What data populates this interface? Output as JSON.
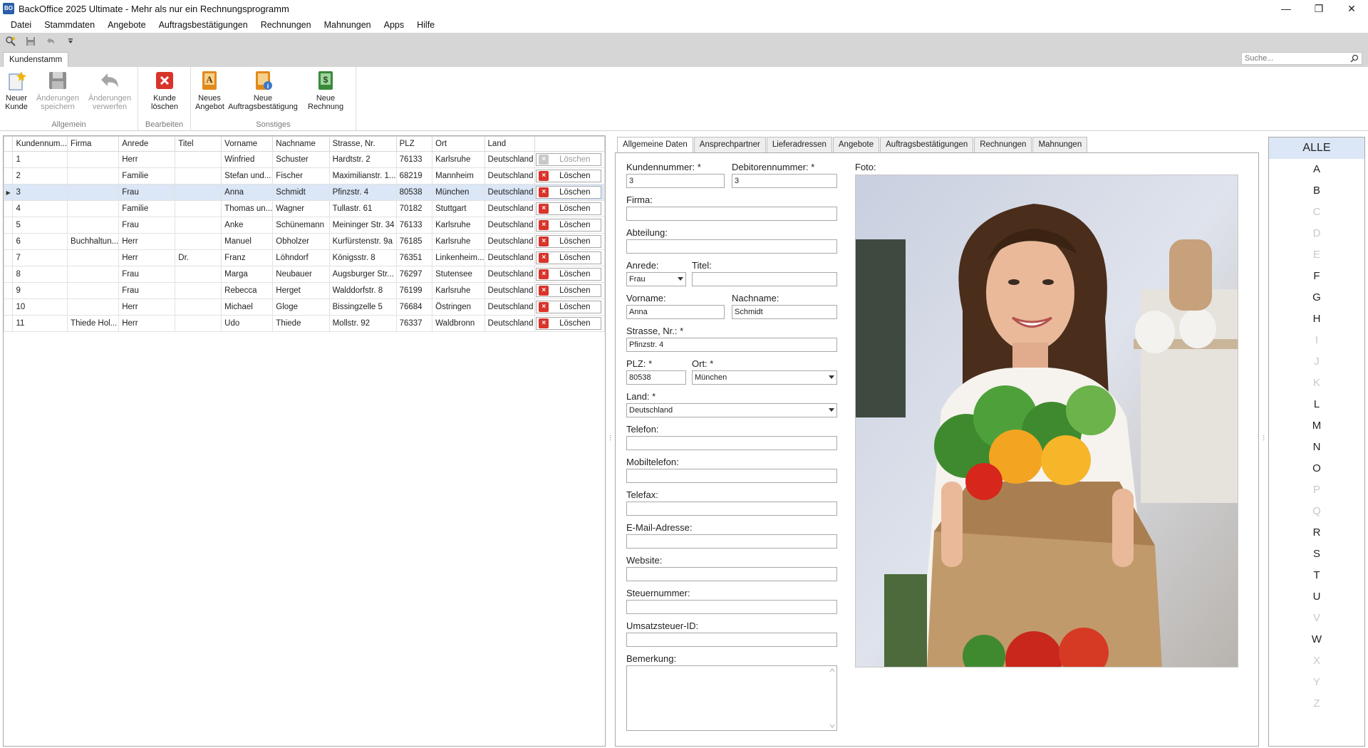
{
  "window": {
    "title": "BackOffice 2025 Ultimate - Mehr als nur ein Rechnungsprogramm",
    "app_icon_text": "BO",
    "minimize": "—",
    "maximize": "❐",
    "close": "✕"
  },
  "menu": [
    "Datei",
    "Stammdaten",
    "Angebote",
    "Auftragsbestätigungen",
    "Rechnungen",
    "Mahnungen",
    "Apps",
    "Hilfe"
  ],
  "ribbon_tab": "Kundenstamm",
  "search": {
    "placeholder": "Suche..."
  },
  "ribbon": {
    "groups": [
      "Allgemein",
      "Bearbeiten",
      "Sonstiges"
    ],
    "new_customer": "Neuer\nKunde",
    "save_changes": "Änderungen\nspeichern",
    "discard_changes": "Änderungen\nverwerfen",
    "delete_customer": "Kunde\nlöschen",
    "new_offer": "Neues\nAngebot",
    "new_order_confirmation": "Neue\nAuftragsbestätigung",
    "new_invoice": "Neue\nRechnung"
  },
  "grid": {
    "headers": [
      "Kundennum...",
      "Firma",
      "Anrede",
      "Titel",
      "Vorname",
      "Nachname",
      "Strasse, Nr.",
      "PLZ",
      "Ort",
      "Land"
    ],
    "delete_label": "Löschen",
    "rows": [
      [
        "1",
        "",
        "Herr",
        "",
        "Winfried",
        "Schuster",
        "Hardtstr. 2",
        "76133",
        "Karlsruhe",
        "Deutschland"
      ],
      [
        "2",
        "",
        "Familie",
        "",
        "Stefan und...",
        "Fischer",
        "Maximilianstr. 1...",
        "68219",
        "Mannheim",
        "Deutschland"
      ],
      [
        "3",
        "",
        "Frau",
        "",
        "Anna",
        "Schmidt",
        "Pfinzstr. 4",
        "80538",
        "München",
        "Deutschland"
      ],
      [
        "4",
        "",
        "Familie",
        "",
        "Thomas un...",
        "Wagner",
        "Tullastr. 61",
        "70182",
        "Stuttgart",
        "Deutschland"
      ],
      [
        "5",
        "",
        "Frau",
        "",
        "Anke",
        "Schünemann",
        "Meininger Str. 34",
        "76133",
        "Karlsruhe",
        "Deutschland"
      ],
      [
        "6",
        "Buchhaltun...",
        "Herr",
        "",
        "Manuel",
        "Obholzer",
        "Kurfürstenstr. 9a",
        "76185",
        "Karlsruhe",
        "Deutschland"
      ],
      [
        "7",
        "",
        "Herr",
        "Dr.",
        "Franz",
        "Löhndorf",
        "Königsstr. 8",
        "76351",
        "Linkenheim...",
        "Deutschland"
      ],
      [
        "8",
        "",
        "Frau",
        "",
        "Marga",
        "Neubauer",
        "Augsburger Str...",
        "76297",
        "Stutensee",
        "Deutschland"
      ],
      [
        "9",
        "",
        "Frau",
        "",
        "Rebecca",
        "Herget",
        "Walddorfstr. 8",
        "76199",
        "Karlsruhe",
        "Deutschland"
      ],
      [
        "10",
        "",
        "Herr",
        "",
        "Michael",
        "Gloge",
        "Bissingzelle 5",
        "76684",
        "Östringen",
        "Deutschland"
      ],
      [
        "11",
        "Thiede Hol...",
        "Herr",
        "",
        "Udo",
        "Thiede",
        "Mollstr. 92",
        "76337",
        "Waldbronn",
        "Deutschland"
      ]
    ]
  },
  "detail_tabs": [
    "Allgemeine Daten",
    "Ansprechpartner",
    "Lieferadressen",
    "Angebote",
    "Auftragsbestätigungen",
    "Rechnungen",
    "Mahnungen"
  ],
  "form": {
    "kundennummer_label": "Kundennummer: *",
    "kundennummer": "3",
    "debitorennummer_label": "Debitorennummer: *",
    "debitorennummer": "3",
    "firma_label": "Firma:",
    "firma": "",
    "abteilung_label": "Abteilung:",
    "abteilung": "",
    "anrede_label": "Anrede:",
    "anrede": "Frau",
    "titel_label": "Titel:",
    "titel": "",
    "vorname_label": "Vorname:",
    "vorname": "Anna",
    "nachname_label": "Nachname:",
    "nachname": "Schmidt",
    "strasse_label": "Strasse, Nr.: *",
    "strasse": "Pfinzstr. 4",
    "plz_label": "PLZ: *",
    "plz": "80538",
    "ort_label": "Ort: *",
    "ort": "München",
    "land_label": "Land: *",
    "land": "Deutschland",
    "telefon_label": "Telefon:",
    "mobiltelefon_label": "Mobiltelefon:",
    "telefax_label": "Telefax:",
    "email_label": "E-Mail-Adresse:",
    "website_label": "Website:",
    "steuernummer_label": "Steuernummer:",
    "ust_label": "Umsatzsteuer-ID:",
    "bemerkung_label": "Bemerkung:",
    "foto_label": "Foto:"
  },
  "alphabet": {
    "all": "ALLE",
    "letters": [
      {
        "l": "A",
        "enabled": true
      },
      {
        "l": "B",
        "enabled": true
      },
      {
        "l": "C",
        "enabled": false
      },
      {
        "l": "D",
        "enabled": false
      },
      {
        "l": "E",
        "enabled": false
      },
      {
        "l": "F",
        "enabled": true
      },
      {
        "l": "G",
        "enabled": true
      },
      {
        "l": "H",
        "enabled": true
      },
      {
        "l": "I",
        "enabled": false
      },
      {
        "l": "J",
        "enabled": false
      },
      {
        "l": "K",
        "enabled": false
      },
      {
        "l": "L",
        "enabled": true
      },
      {
        "l": "M",
        "enabled": true
      },
      {
        "l": "N",
        "enabled": true
      },
      {
        "l": "O",
        "enabled": true
      },
      {
        "l": "P",
        "enabled": false
      },
      {
        "l": "Q",
        "enabled": false
      },
      {
        "l": "R",
        "enabled": true
      },
      {
        "l": "S",
        "enabled": true
      },
      {
        "l": "T",
        "enabled": true
      },
      {
        "l": "U",
        "enabled": true
      },
      {
        "l": "V",
        "enabled": false
      },
      {
        "l": "W",
        "enabled": true
      },
      {
        "l": "X",
        "enabled": false
      },
      {
        "l": "Y",
        "enabled": false
      },
      {
        "l": "Z",
        "enabled": false
      }
    ]
  },
  "colors": {
    "selection": "#dbe6f6",
    "ribbon_bg": "#d6d6d6",
    "delete_red": "#d9342b",
    "border": "#a9a9a9"
  }
}
